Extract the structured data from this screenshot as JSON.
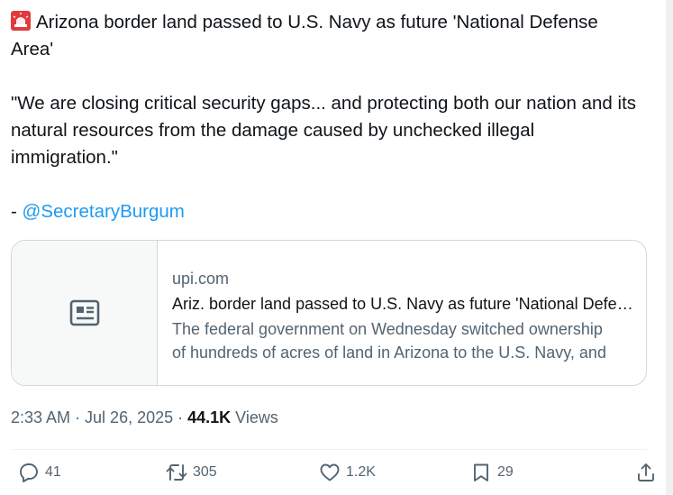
{
  "tweet": {
    "icons": {
      "alert": "rotating-light-icon"
    },
    "line1": "Arizona border land passed to U.S. Navy as future 'National Defense Area'",
    "quote": "\"We are closing critical security gaps... and protecting both our nation and its natural resources from the damage caused by unchecked illegal immigration.\"",
    "attribution_prefix": "- ",
    "mention": "@SecretaryBurgum"
  },
  "card": {
    "thumb_icon": "news-article-icon",
    "domain": "upi.com",
    "title": "Ariz. border land passed to U.S. Navy as future 'National Defense Area'",
    "desc_line1": "The federal government on Wednesday switched ownership",
    "desc_line2": "of hundreds of acres of land in Arizona to the U.S. Navy, and"
  },
  "meta": {
    "time": "2:33 AM",
    "sep1": " · ",
    "date": "Jul 26, 2025",
    "sep2": " · ",
    "views_count": "44.1K",
    "views_label": " Views"
  },
  "actions": {
    "replies": {
      "icon": "reply-icon",
      "count": "41"
    },
    "reposts": {
      "icon": "repost-icon",
      "count": "305"
    },
    "likes": {
      "icon": "heart-icon",
      "count": "1.2K"
    },
    "bookmarks": {
      "icon": "bookmark-icon",
      "count": "29"
    },
    "share": {
      "icon": "share-icon"
    }
  },
  "colors": {
    "text": "#0f1419",
    "secondary": "#536471",
    "link": "#1d9bf0",
    "border": "#cfd9de"
  }
}
